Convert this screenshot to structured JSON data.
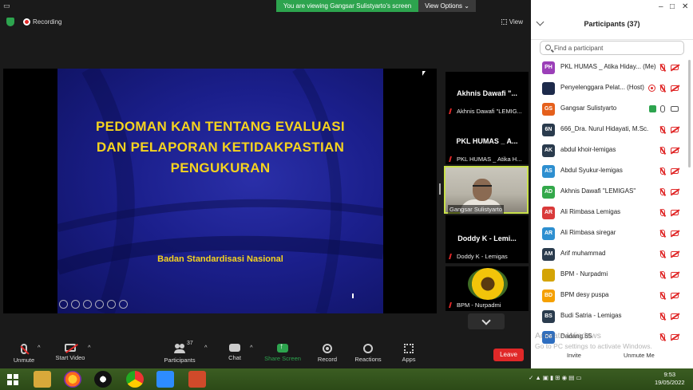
{
  "share_banner": {
    "message": "You are viewing Gangsar Sulistyarto's screen",
    "view_options": "View Options"
  },
  "top_bar": {
    "recording": "Recording",
    "view": "View"
  },
  "slide": {
    "title_lines": [
      "PEDOMAN KAN TENTANG EVALUASI",
      "DAN PELAPORAN KETIDAKPASTIAN",
      "PENGUKURAN"
    ],
    "subtitle": "Badan Standardisasi Nasional"
  },
  "gallery": [
    {
      "big": "Akhnis Dawafi \"...",
      "small": "Akhnis Dawafi \"LEMIG..."
    },
    {
      "big": "PKL HUMAS _ A...",
      "small": "PKL HUMAS _ Atika H..."
    },
    {
      "big": "",
      "small": "Gangsar Sulistyarto"
    },
    {
      "big": "Doddy K - Lemi...",
      "small": "Doddy K - Lemigas"
    },
    {
      "big": "",
      "small": "BPM - Nurpadmi"
    }
  ],
  "toolbar": {
    "unmute": "Unmute",
    "start_video": "Start Video",
    "participants": "Participants",
    "participants_count": "37",
    "chat": "Chat",
    "share_screen": "Share Screen",
    "record": "Record",
    "reactions": "Reactions",
    "apps": "Apps",
    "leave": "Leave"
  },
  "panel": {
    "title": "Participants (37)",
    "search_placeholder": "Find a participant",
    "invite": "Invite",
    "unmute_me": "Unmute Me",
    "participants": [
      {
        "initials": "PH",
        "name": "PKL HUMAS _ Atika Hiday... (Me)",
        "color": "#9b3fb8",
        "mic": "muted",
        "cam": "off",
        "extra": ""
      },
      {
        "initials": "",
        "name": "Penyelenggara Pelat... (Host)",
        "color": "#1d2a4a",
        "mic": "muted",
        "cam": "off",
        "extra": "record"
      },
      {
        "initials": "GS",
        "name": "Gangsar Sulistyarto",
        "color": "#e5601c",
        "mic": "on",
        "cam": "on",
        "extra": "share"
      },
      {
        "initials": "6N",
        "name": "666_Dra. Nurul Hidayati, M.Sc.",
        "color": "#2a3b4d",
        "mic": "muted",
        "cam": "off",
        "extra": ""
      },
      {
        "initials": "AK",
        "name": "abdul khoir-lemigas",
        "color": "#2a3b4d",
        "mic": "muted",
        "cam": "off",
        "extra": ""
      },
      {
        "initials": "AS",
        "name": "Abdul Syukur-lemigas",
        "color": "#2e8fd0",
        "mic": "muted",
        "cam": "off",
        "extra": ""
      },
      {
        "initials": "AD",
        "name": "Akhnis Dawafi \"LEMIGAS\"",
        "color": "#33a84a",
        "mic": "muted",
        "cam": "off",
        "extra": ""
      },
      {
        "initials": "AR",
        "name": "Ali Rimbasa Lemigas",
        "color": "#d93a3a",
        "mic": "muted",
        "cam": "off",
        "extra": ""
      },
      {
        "initials": "AR",
        "name": "Ali Rimbasa siregar",
        "color": "#2e8fd0",
        "mic": "muted",
        "cam": "off",
        "extra": ""
      },
      {
        "initials": "AM",
        "name": "Arif muhammad",
        "color": "#2a3b4d",
        "mic": "muted",
        "cam": "off",
        "extra": ""
      },
      {
        "initials": "",
        "name": "BPM - Nurpadmi",
        "color": "#d4a406",
        "mic": "muted",
        "cam": "off",
        "extra": ""
      },
      {
        "initials": "BD",
        "name": "BPM desy puspa",
        "color": "#f5a000",
        "mic": "muted",
        "cam": "off",
        "extra": ""
      },
      {
        "initials": "BS",
        "name": "Budi Satria - Lemigas",
        "color": "#2a3b4d",
        "mic": "muted",
        "cam": "off",
        "extra": ""
      },
      {
        "initials": "D6",
        "name": "Dadang 65",
        "color": "#2e6ec0",
        "mic": "muted",
        "cam": "off",
        "extra": ""
      }
    ]
  },
  "watermark": {
    "line1": "Activate Windows",
    "line2": "Go to PC settings to activate Windows."
  },
  "taskbar": {
    "time": "9:53",
    "date": "19/05/2022"
  }
}
